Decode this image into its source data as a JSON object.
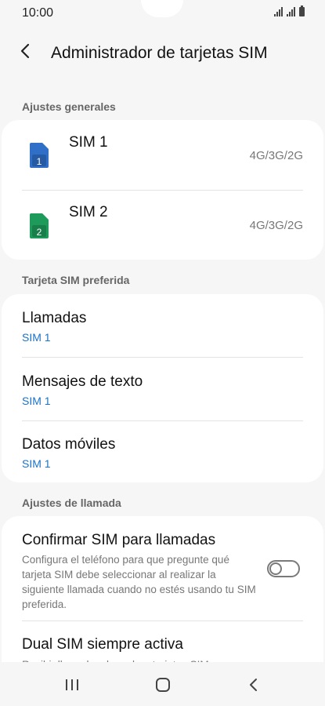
{
  "status_bar": {
    "time": "10:00"
  },
  "header": {
    "title": "Administrador de tarjetas SIM"
  },
  "sections": {
    "general": "Ajustes generales",
    "preferred": "Tarjeta SIM preferida",
    "calls": "Ajustes de llamada"
  },
  "sims": [
    {
      "name": "SIM 1",
      "number": "1",
      "network": "4G/3G/2G",
      "color": "#2f6fc8"
    },
    {
      "name": "SIM 2",
      "number": "2",
      "network": "4G/3G/2G",
      "color": "#1e9a5b"
    }
  ],
  "preferred": [
    {
      "title": "Llamadas",
      "value": "SIM 1"
    },
    {
      "title": "Mensajes de texto",
      "value": "SIM 1"
    },
    {
      "title": "Datos móviles",
      "value": "SIM 1"
    }
  ],
  "call_settings": {
    "confirm": {
      "title": "Confirmar SIM para llamadas",
      "description": "Configura el teléfono para que pregunte qué tarjeta SIM debe seleccionar al realizar la siguiente llamada cuando no estés usando tu SIM preferida.",
      "enabled": false
    },
    "dual": {
      "title": "Dual SIM siempre activa",
      "description": "Recibir llamadas de ambas tarjetas SIM"
    }
  },
  "colors": {
    "accent": "#1a73c8",
    "background": "#f6f6f6",
    "card": "#ffffff"
  }
}
